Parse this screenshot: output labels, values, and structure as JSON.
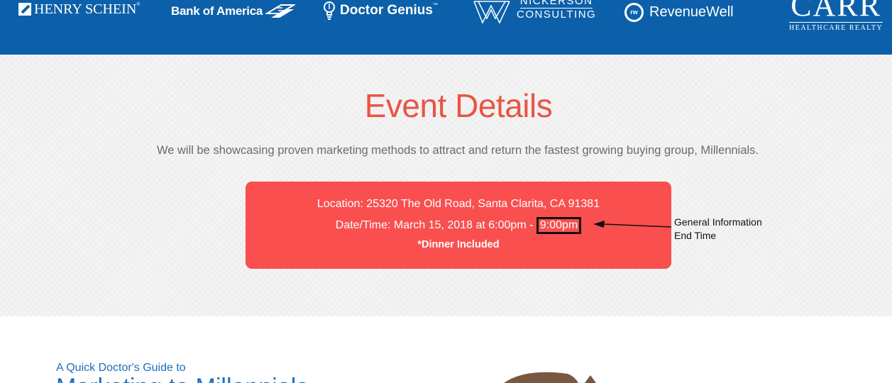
{
  "sponsors": {
    "henry_schein": "HENRY SCHEIN",
    "henry_schein_mark": "®",
    "bank_of_america": "Bank of America",
    "doctor_genius": "Doctor Genius",
    "doctor_genius_mark": "™",
    "nickerson_line1": "NICKERSON",
    "nickerson_line2": "CONSULTING",
    "revenuewell_badge": "rw",
    "revenuewell": "RevenueWell",
    "carr_big": "CARR",
    "carr_small": "HEALTHCARE REALTY"
  },
  "event": {
    "title": "Event Details",
    "description": "We will be showcasing proven marketing methods to attract and return the fastest growing buying group, Millennials.",
    "location": "Location: 25320 The Old Road, Santa Clarita, CA 91381",
    "datetime_prefix": "Date/Time: March 15, 2018 at 6:00pm - ",
    "end_time": "9:00pm",
    "dinner": "*Dinner Included"
  },
  "annotation": {
    "line1": "General Information",
    "line2": "End Time"
  },
  "guide": {
    "small_title": "A Quick Doctor's Guide to",
    "big_title": "Marketing to Millennials"
  },
  "colors": {
    "header_bg": "#0c60aa",
    "title_red": "#e85545",
    "box_red": "#f94f4f",
    "guide_blue": "#1a6fbd"
  },
  "icons": [
    "lightbulb-icon",
    "flag-icon",
    "mountains-icon",
    "revenuewell-badge-icon",
    "dog-illustration"
  ]
}
